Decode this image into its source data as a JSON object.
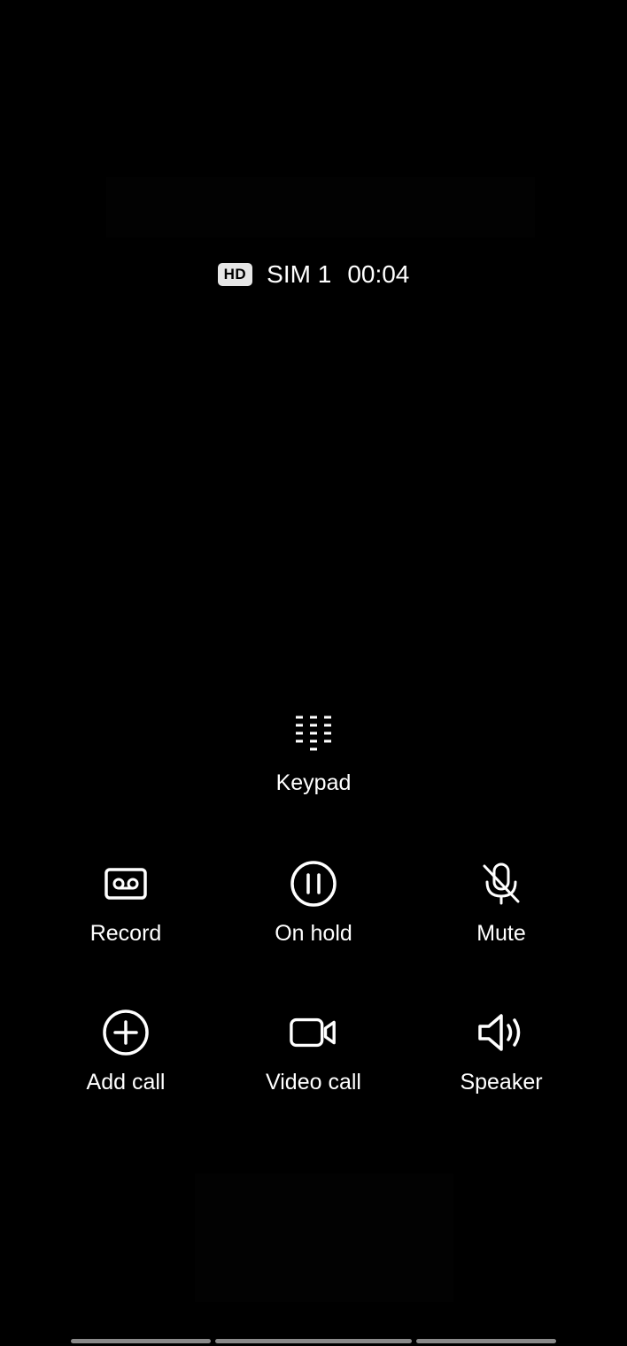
{
  "call_status": {
    "hd_badge": "HD",
    "sim": "SIM 1",
    "duration": "00:04"
  },
  "keypad": {
    "label": "Keypad",
    "icon": "keypad-icon"
  },
  "actions_row1": [
    {
      "label": "Record",
      "icon": "record-icon"
    },
    {
      "label": "On hold",
      "icon": "pause-icon"
    },
    {
      "label": "Mute",
      "icon": "mic-off-icon"
    }
  ],
  "actions_row2": [
    {
      "label": "Add call",
      "icon": "add-icon"
    },
    {
      "label": "Video call",
      "icon": "video-icon"
    },
    {
      "label": "Speaker",
      "icon": "speaker-icon"
    }
  ],
  "colors": {
    "background": "#000000",
    "text": "#ffffff",
    "hd_badge_bg": "#e6e6e6"
  }
}
